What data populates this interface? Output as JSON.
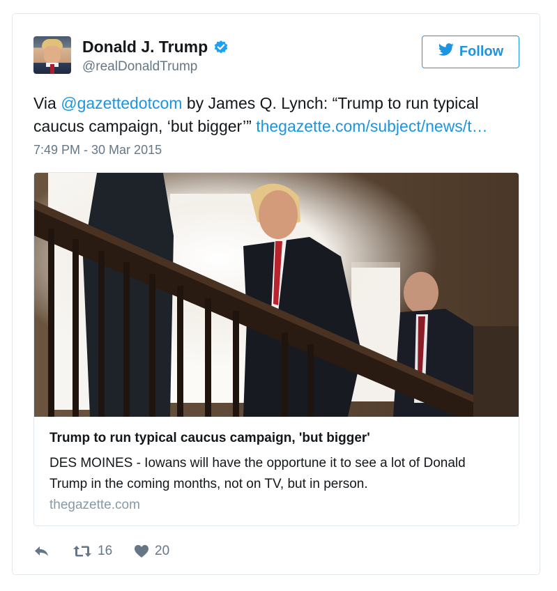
{
  "author": {
    "name": "Donald J. Trump",
    "handle": "@realDonaldTrump",
    "verified": true
  },
  "follow_button": {
    "label": "Follow",
    "icon": "bird-icon",
    "color": "#1b95e0"
  },
  "tweet": {
    "prefix": "Via ",
    "mention": "@gazettedotcom",
    "text": " by James Q. Lynch: “Trump to run typical caucus campaign, ‘but bigger’” ",
    "link": "thegazette.com/subject/news/t…",
    "timestamp": "7:49 PM - 30 Mar 2015"
  },
  "link_card": {
    "title": "Trump to run typical caucus campaign, 'but bigger'",
    "description": "DES MOINES - Iowans will have the opportune it to see a lot of Donald Trump in the coming months, not on TV, but in person.",
    "domain": "thegazette.com"
  },
  "actions": {
    "reply": {
      "icon": "reply-icon"
    },
    "retweet": {
      "icon": "retweet-icon",
      "count": "16"
    },
    "like": {
      "icon": "heart-icon",
      "count": "20"
    }
  },
  "colors": {
    "link": "#1b95e0",
    "secondary": "#657786",
    "border": "#e1e8ed"
  }
}
